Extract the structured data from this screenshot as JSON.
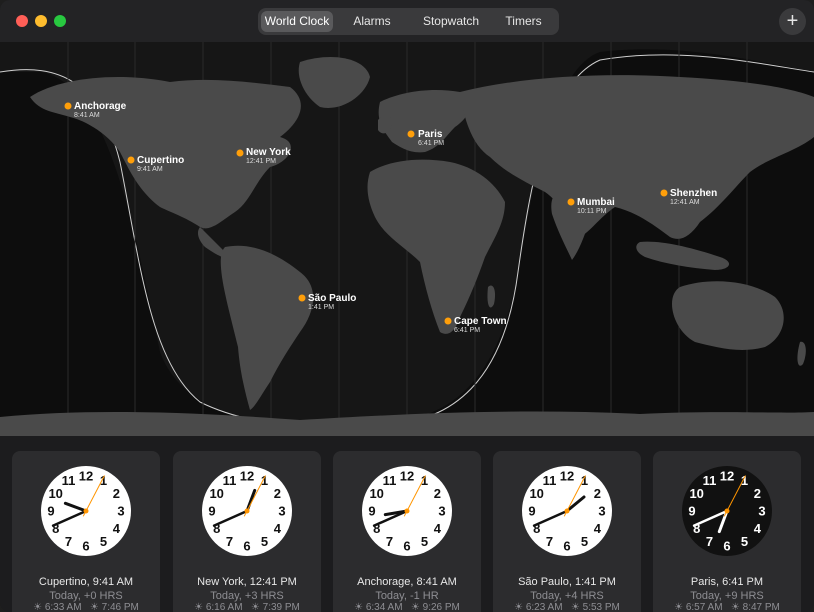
{
  "toolbar": {
    "tabs": [
      {
        "label": "World Clock",
        "active": true
      },
      {
        "label": "Alarms",
        "active": false
      },
      {
        "label": "Stopwatch",
        "active": false
      },
      {
        "label": "Timers",
        "active": false
      }
    ],
    "add_label": "+"
  },
  "map": {
    "pins": [
      {
        "city": "Anchorage",
        "time": "8:41 AM"
      },
      {
        "city": "Cupertino",
        "time": "9:41 AM"
      },
      {
        "city": "New York",
        "time": "12:41 PM"
      },
      {
        "city": "Paris",
        "time": "6:41 PM"
      },
      {
        "city": "Mumbai",
        "time": "10:11 PM"
      },
      {
        "city": "Shenzhen",
        "time": "12:41 AM"
      },
      {
        "city": "São Paulo",
        "time": "1:41 PM"
      },
      {
        "city": "Cape Town",
        "time": "6:41 PM"
      }
    ]
  },
  "clocks": [
    {
      "city_time": "Cupertino, 9:41 AM",
      "offset": "Today, +0 HRS",
      "sunrise": "6:33 AM",
      "sunset": "7:46 PM",
      "hour": 9,
      "minute": 41,
      "dark": false
    },
    {
      "city_time": "New York, 12:41 PM",
      "offset": "Today, +3 HRS",
      "sunrise": "6:16 AM",
      "sunset": "7:39 PM",
      "hour": 12,
      "minute": 41,
      "dark": false
    },
    {
      "city_time": "Anchorage, 8:41 AM",
      "offset": "Today, -1 HR",
      "sunrise": "6:34 AM",
      "sunset": "9:26 PM",
      "hour": 8,
      "minute": 41,
      "dark": false
    },
    {
      "city_time": "São Paulo, 1:41 PM",
      "offset": "Today, +4 HRS",
      "sunrise": "6:23 AM",
      "sunset": "5:53 PM",
      "hour": 1,
      "minute": 41,
      "dark": false
    },
    {
      "city_time": "Paris, 6:41 PM",
      "offset": "Today, +9 HRS",
      "sunrise": "6:57 AM",
      "sunset": "8:47 PM",
      "hour": 6,
      "minute": 41,
      "dark": true
    }
  ],
  "colors": {
    "accent": "#ff9f0a",
    "second_hand": "#ff9500",
    "window_bg": "#1c1c1e",
    "card_bg": "#2c2c2e",
    "land": "#4a4a4a"
  }
}
